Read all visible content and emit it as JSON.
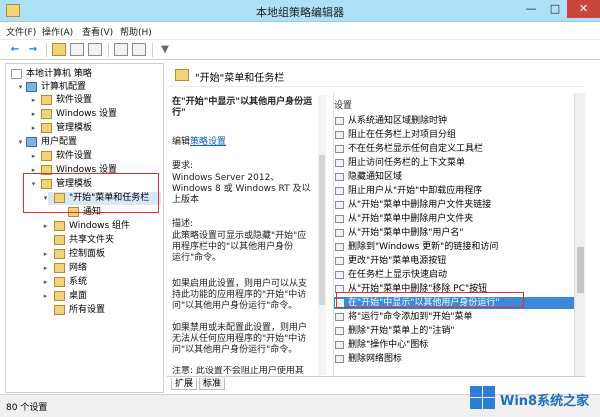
{
  "window": {
    "title": "本地组策略编辑器",
    "min_glyph": "—",
    "max_glyph": "□",
    "close_glyph": "✕"
  },
  "menu": {
    "items": [
      "文件(F)",
      "操作(A)",
      "查看(V)",
      "帮助(H)"
    ]
  },
  "toolbar": {
    "back": "←",
    "forward": "→",
    "filter": "▼"
  },
  "tree": {
    "root": "本地计算机 策略",
    "computer_config": "计算机配置",
    "software_settings": "软件设置",
    "windows_settings": "Windows 设置",
    "admin_templates": "管理模板",
    "user_config": "用户配置",
    "user_software_settings": "软件设置",
    "user_windows_settings": "Windows 设置",
    "user_admin_templates": "管理模板",
    "start_menu_taskbar": "\"开始\"菜单和任务栏",
    "notifications": "通知",
    "windows_components": "Windows 组件",
    "shared_folders": "共享文件夹",
    "control_panel": "控制面板",
    "network": "网络",
    "system": "系统",
    "desktop": "桌面",
    "all_settings": "所有设置"
  },
  "header": {
    "title": "\"开始\"菜单和任务栏"
  },
  "details": {
    "policy_title": "在\"开始\"中显示\"以其他用户身份运行\"",
    "edit_prefix": "编辑",
    "edit_link": "策略设置",
    "requirements_label": "要求:",
    "requirements": "Windows Server 2012、\nWindows 8 或 Windows RT 及以\n上版本",
    "description_label": "描述:",
    "description": "此策略设置可显示或隐藏\"开始\"应\n用程序栏中的\"以其他用户身份\n运行\"命令。",
    "enabled_text": "如果启用此设置，则用户可以从支\n持此功能的应用程序的\"开始\"中访\n问\"以其他用户身份运行\"命令。",
    "disabled_text": "如果禁用或未配置此设置，则用户\n无法从任何应用程序的\"开始\"中访\n问\"以其他用户身份运行\"命令。",
    "note_text": "注意: 此设置不会阻止用户使用其"
  },
  "settings": {
    "header": "设置",
    "items": [
      "从系统通知区域删除时钟",
      "阻止在任务栏上对项目分组",
      "不在任务栏显示任何自定义工具栏",
      "阻止访问任务栏的上下文菜单",
      "隐藏通知区域",
      "阻止用户从\"开始\"中卸载应用程序",
      "从\"开始\"菜单中删除用户文件夹链接",
      "从\"开始\"菜单中删除用户文件夹",
      "从\"开始\"菜单中删除\"用户名\"",
      "删除到\"Windows 更新\"的链接和访问",
      "更改\"开始\"菜单电源按钮",
      "在任务栏上显示快速启动",
      "从\"开始\"菜单中删除\"移除 PC\"按钮",
      "在\"开始\"中显示\"以其他用户身份运行\"",
      "将\"运行\"命令添加到\"开始\"菜单",
      "删除\"开始\"菜单上的\"注销\"",
      "删除\"操作中心\"图标",
      "删除网络图标"
    ]
  },
  "tabs": {
    "extended": "扩展",
    "standard": "标准"
  },
  "status": {
    "text": "80 个设置"
  },
  "watermark": {
    "text": "Win8系统之家"
  },
  "colors": {
    "titlebar": "#aee0f8",
    "selection": "#3b89d9",
    "highlight_box": "#e0302a",
    "link": "#0b5fbf",
    "folder": "#f2d37a"
  }
}
